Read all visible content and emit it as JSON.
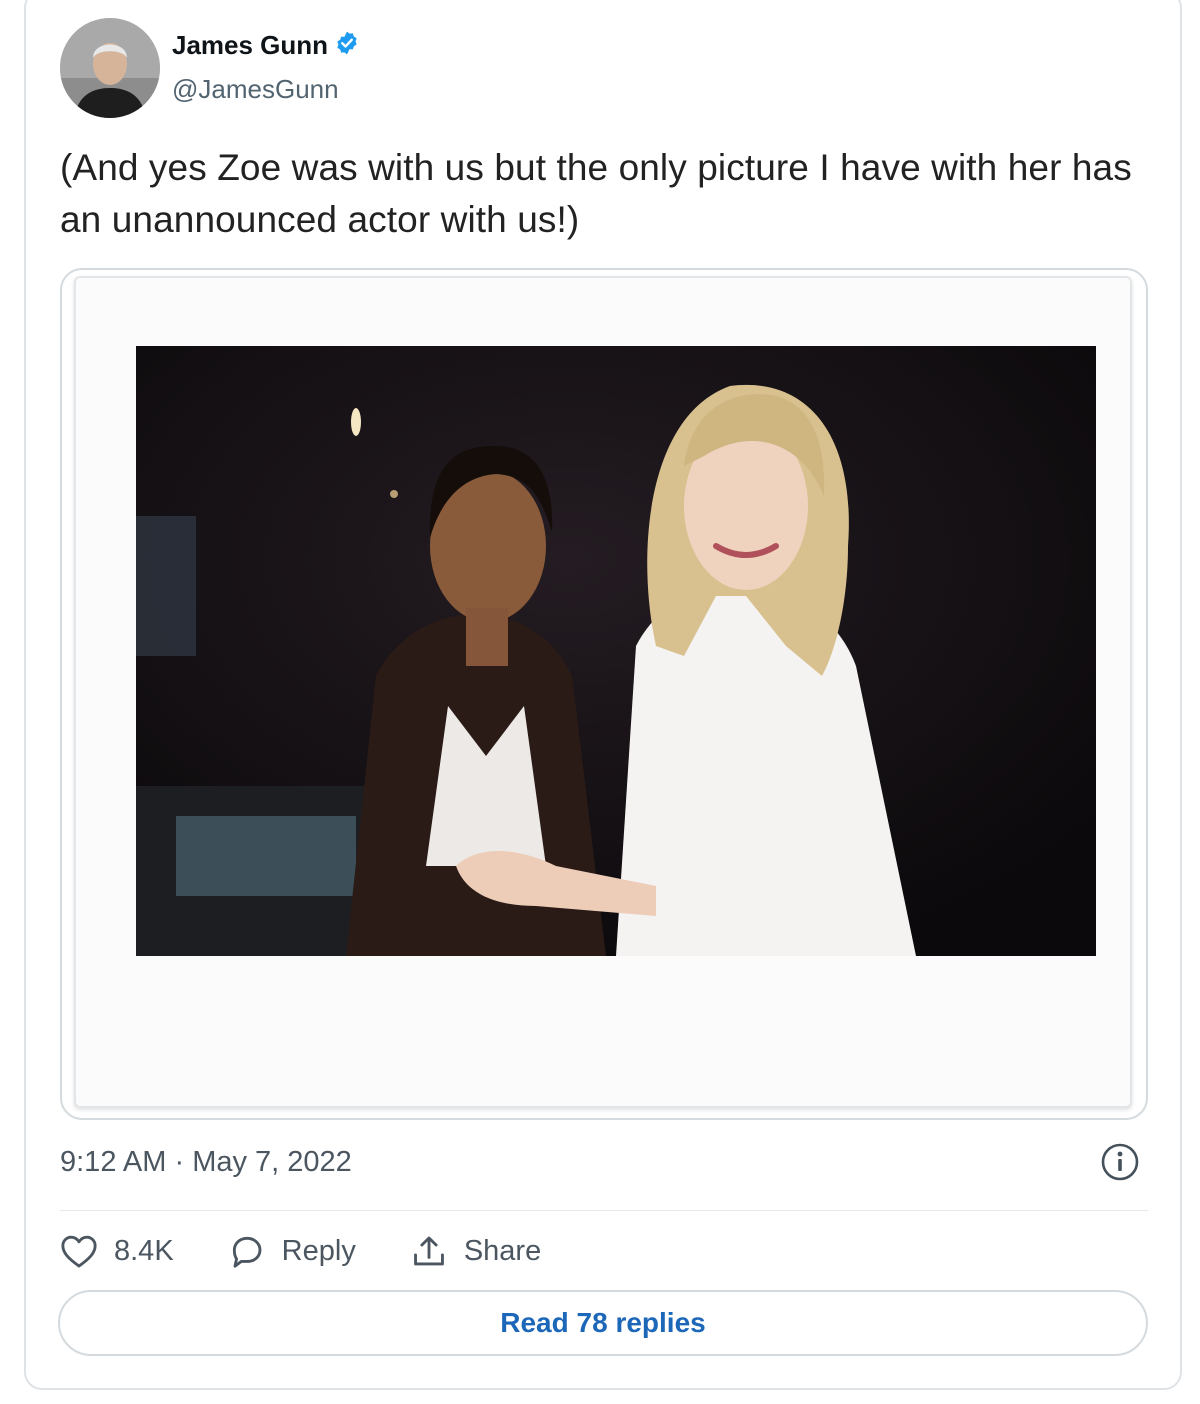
{
  "author": {
    "display_name": "James Gunn",
    "handle": "@JamesGunn",
    "verified_icon": "verified-badge-icon",
    "verified_color": "#1d9bf0"
  },
  "tweet": {
    "text": "(And yes Zoe was with us but the only picture I have with her has an unannounced actor with us!)",
    "time": "9:12 AM",
    "separator": "·",
    "date": "May 7, 2022"
  },
  "actions": {
    "like_count": "8.4K",
    "like_icon": "heart-icon",
    "reply_label": "Reply",
    "reply_icon": "speech-bubble-icon",
    "share_label": "Share",
    "share_icon": "share-upload-icon"
  },
  "read_replies_label": "Read 78 replies",
  "colors": {
    "link": "#1d67b8",
    "muted_text": "#536471",
    "border": "#d4dadd"
  }
}
